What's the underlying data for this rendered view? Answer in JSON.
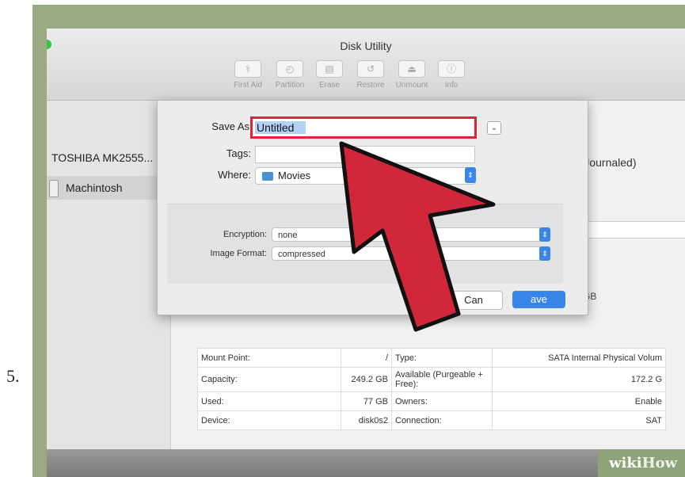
{
  "step_number": "5.",
  "window": {
    "title": "Disk Utility"
  },
  "toolbar": {
    "items": [
      {
        "label": "First Aid",
        "icon": "stethoscope-icon",
        "glyph": "⚕"
      },
      {
        "label": "Partition",
        "icon": "partition-icon",
        "glyph": "◴"
      },
      {
        "label": "Erase",
        "icon": "erase-icon",
        "glyph": "▤"
      },
      {
        "label": "Restore",
        "icon": "restore-icon",
        "glyph": "↺"
      },
      {
        "label": "Unmount",
        "icon": "eject-icon",
        "glyph": "⏏"
      },
      {
        "label": "Info",
        "icon": "info-icon",
        "glyph": "ⓘ"
      }
    ]
  },
  "sidebar": {
    "disk": "TOSHIBA MK2555...",
    "volume": "Machintosh"
  },
  "content": {
    "format_partial": "d (Journaled)",
    "size_partial": "1 GB"
  },
  "save_sheet": {
    "save_as_label": "Save As",
    "save_as_value": "Untitled",
    "tags_label": "Tags:",
    "tags_value": "",
    "where_label": "Where:",
    "where_value": "Movies",
    "encryption_label": "Encryption:",
    "encryption_value": "none",
    "image_format_label": "Image Format:",
    "image_format_value": "compressed",
    "cancel_partial": "Can",
    "save_partial": "ave"
  },
  "info_table": {
    "rows": [
      {
        "k1": "Mount Point:",
        "v1": "/",
        "k2": "Type:",
        "v2": "SATA Internal Physical Volum"
      },
      {
        "k1": "Capacity:",
        "v1": "249.2 GB",
        "k2": "Available (Purgeable + Free):",
        "v2": "172.2 G"
      },
      {
        "k1": "Used:",
        "v1": "77 GB",
        "k2": "Owners:",
        "v2": "Enable"
      },
      {
        "k1": "Device:",
        "v1": "disk0s2",
        "k2": "Connection:",
        "v2": "SAT"
      }
    ]
  },
  "watermark": {
    "wiki": "wiki",
    "how": "How"
  },
  "colors": {
    "highlight_red": "#e0253a",
    "arrow_red": "#d0283a",
    "accent_blue": "#3a86e8",
    "frame_green": "#9aaa84"
  }
}
